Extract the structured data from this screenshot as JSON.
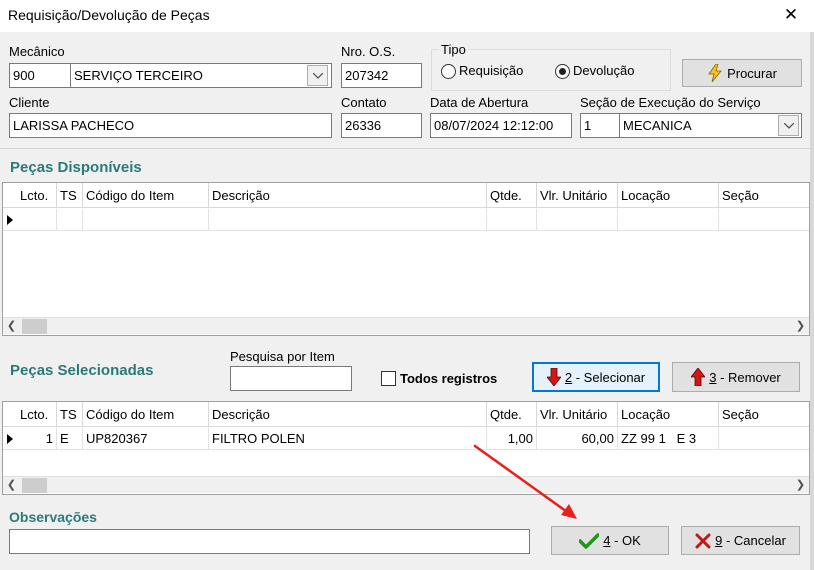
{
  "window": {
    "title": "Requisição/Devolução de Peças",
    "close_glyph": "✕"
  },
  "header": {
    "mecanico": {
      "label": "Mecânico",
      "code": "900",
      "name": "SERVIÇO TERCEIRO"
    },
    "nro_os": {
      "label": "Nro. O.S.",
      "value": "207342"
    },
    "tipo": {
      "label": "Tipo",
      "options": [
        {
          "label": "Requisição",
          "selected": false
        },
        {
          "label": "Devolução",
          "selected": true
        }
      ]
    },
    "procurar_label": "Procurar",
    "cliente": {
      "label": "Cliente",
      "value": "LARISSA PACHECO"
    },
    "contato": {
      "label": "Contato",
      "value": "26336"
    },
    "data_abertura": {
      "label": "Data de Abertura",
      "value": "08/07/2024 12:12:00"
    },
    "secao": {
      "label": "Seção de Execução do Serviço",
      "code": "1",
      "name": "MECANICA"
    }
  },
  "pecas_disponiveis": {
    "title": "Peças Disponíveis",
    "columns": [
      "Lcto.",
      "TS",
      "Código do Item",
      "Descrição",
      "Qtde.",
      "Vlr. Unitário",
      "Locação",
      "Seção"
    ],
    "rows": []
  },
  "pecas_selecionadas": {
    "title": "Peças Selecionadas",
    "pesquisa_label": "Pesquisa por Item",
    "pesquisa_value": "",
    "todos_label": "Todos registros",
    "selecionar": {
      "key": "2",
      "text": " - Selecionar"
    },
    "remover": {
      "key": "3",
      "text": " - Remover"
    },
    "columns": [
      "Lcto.",
      "TS",
      "Código do Item",
      "Descrição",
      "Qtde.",
      "Vlr. Unitário",
      "Locação",
      "Seção"
    ],
    "rows": [
      {
        "lcto": "1",
        "ts": "E",
        "codigo": "UP820367",
        "descricao": "FILTRO POLEN",
        "qtde": "1,00",
        "vlr": "60,00",
        "locacao": "ZZ 99 1   E 3",
        "secao": ""
      }
    ]
  },
  "observacoes": {
    "label": "Observações",
    "value": ""
  },
  "actions": {
    "ok": {
      "key": "4",
      "text": " - OK"
    },
    "cancel": {
      "key": "9",
      "text": " - Cancelar"
    }
  },
  "colors": {
    "section_title": "#2a7a7a",
    "focus_border": "#0078d7",
    "annotation_arrow": "#e8201a"
  }
}
